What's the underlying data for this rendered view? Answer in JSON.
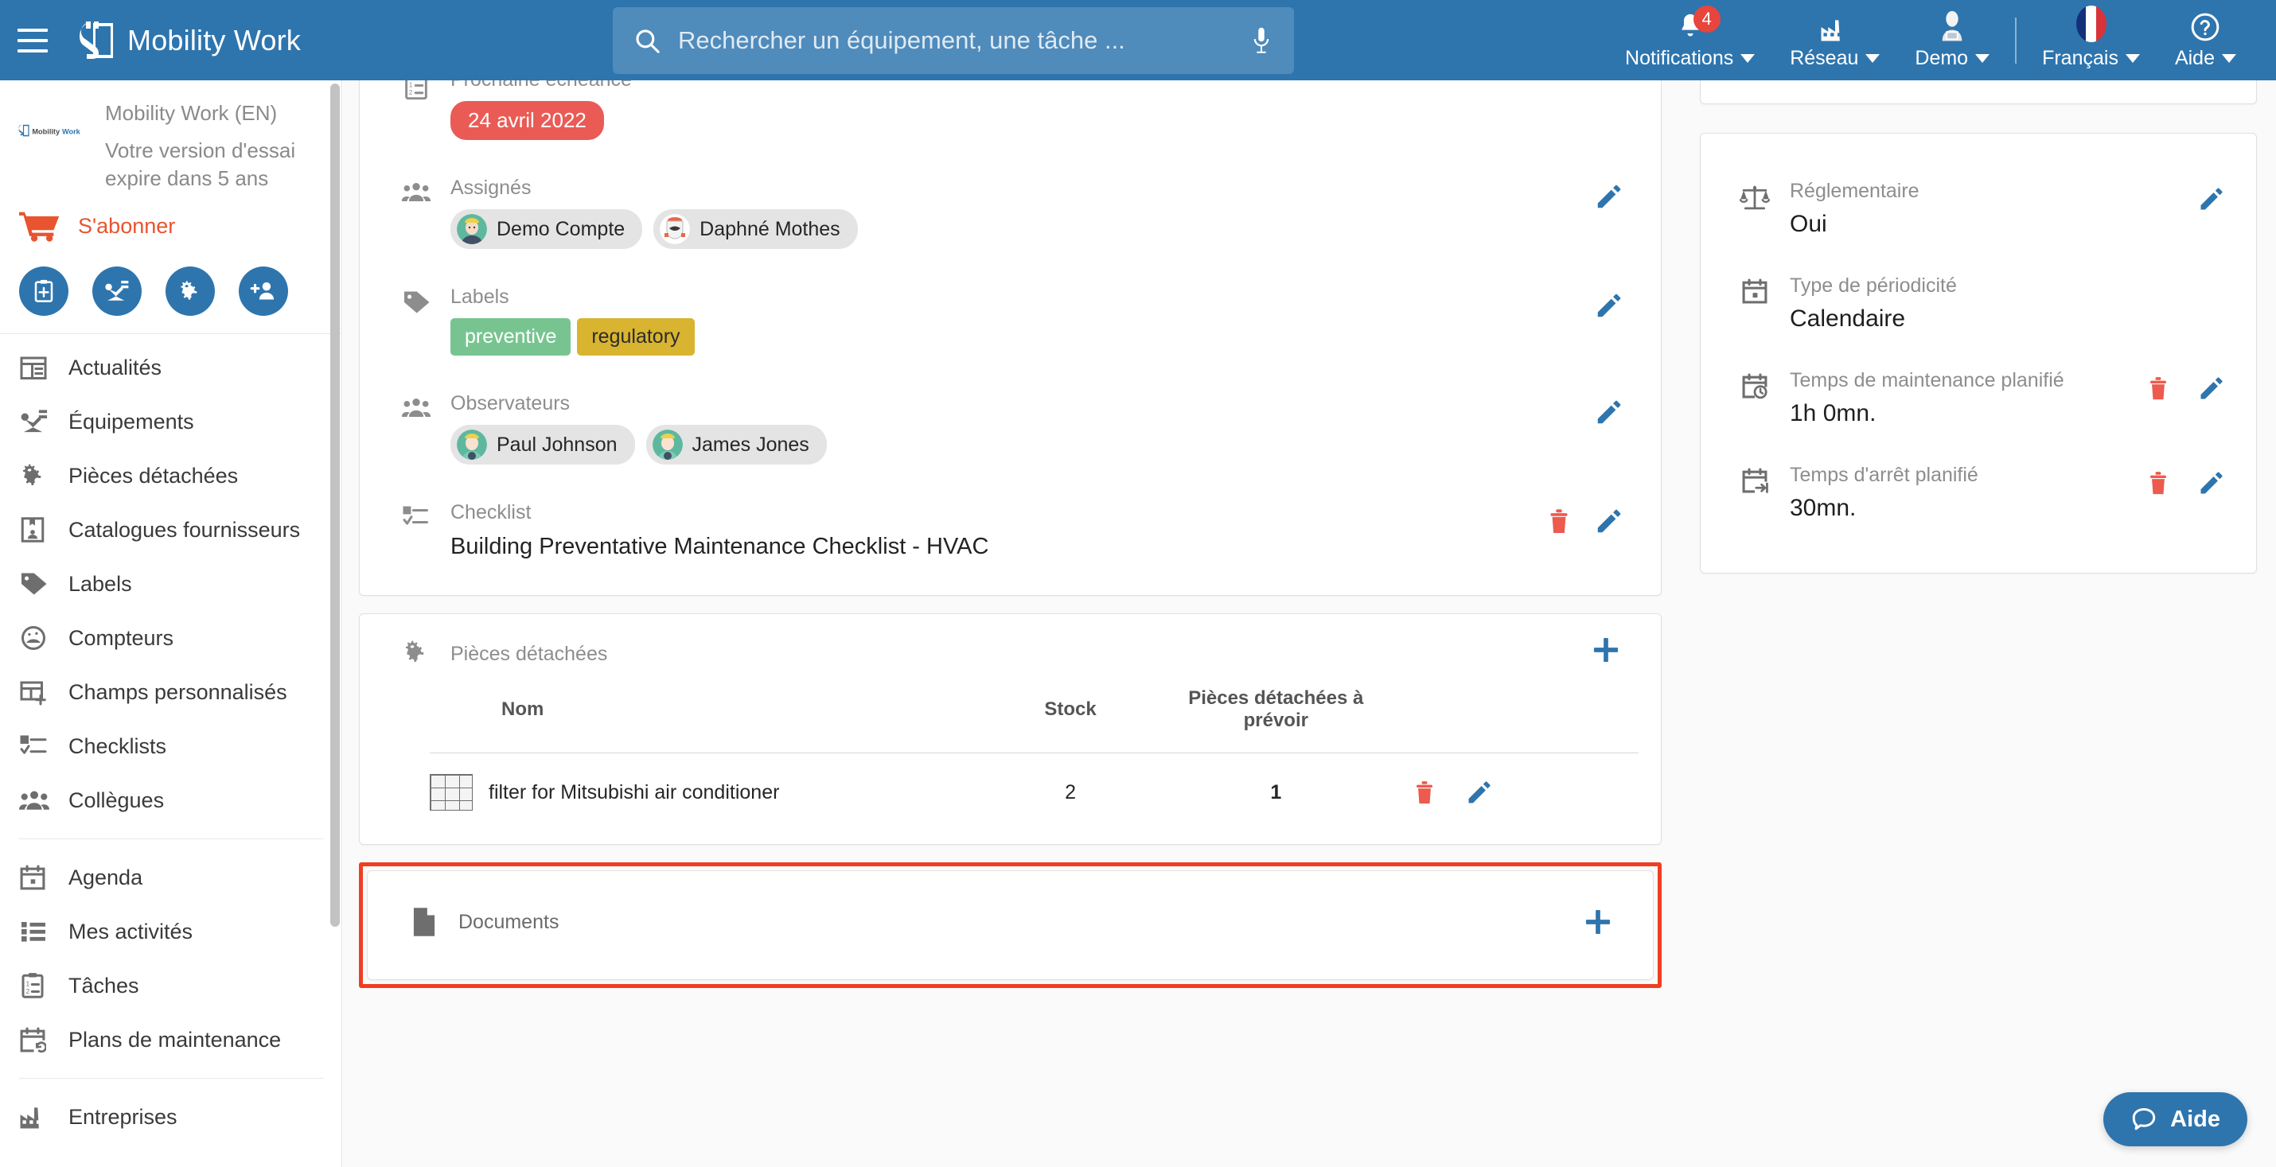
{
  "header": {
    "brand": "Mobility Work",
    "menu_icon": "hamburger-icon",
    "search": {
      "placeholder": "Rechercher un équipement, une tâche ...",
      "value": ""
    },
    "actions": [
      {
        "label": "Notifications",
        "badge": "4",
        "icon": "bell-icon"
      },
      {
        "label": "Réseau",
        "icon": "factory-icon"
      },
      {
        "label": "Demo",
        "icon": "user-avatar-icon"
      },
      {
        "label": "Français",
        "icon": "flag-fr-icon"
      },
      {
        "label": "Aide",
        "icon": "question-circle-icon"
      }
    ]
  },
  "sidebar": {
    "trial": {
      "account": "Mobility Work (EN)",
      "notice": "Votre version d'essai expire dans 5 ans",
      "logo_text": "Mobility Work"
    },
    "subscribe": {
      "label": "S'abonner",
      "icon": "cart-icon",
      "color": "#e8542f"
    },
    "quick_actions": [
      {
        "icon": "clipboard-plus-icon",
        "name": "new-task"
      },
      {
        "icon": "robot-arm-icon",
        "name": "new-equipment"
      },
      {
        "icon": "gears-icon",
        "name": "new-spare-part"
      },
      {
        "icon": "user-plus-icon",
        "name": "invite-colleague"
      }
    ],
    "items": [
      {
        "label": "Actualités",
        "icon": "news-icon"
      },
      {
        "label": "Équipements",
        "icon": "robot-arm-icon"
      },
      {
        "label": "Pièces détachées",
        "icon": "gears-icon"
      },
      {
        "label": "Catalogues fournisseurs",
        "icon": "catalog-icon"
      },
      {
        "label": "Labels",
        "icon": "tag-icon"
      },
      {
        "label": "Compteurs",
        "icon": "gauge-icon"
      },
      {
        "label": "Champs personnalisés",
        "icon": "table-plus-icon"
      },
      {
        "label": "Checklists",
        "icon": "checklist-icon"
      },
      {
        "label": "Collègues",
        "icon": "people-icon"
      },
      {
        "label": "Agenda",
        "icon": "calendar-icon"
      },
      {
        "label": "Mes activités",
        "icon": "list-icon"
      },
      {
        "label": "Tâches",
        "icon": "clipboard-list-icon"
      },
      {
        "label": "Plans de maintenance",
        "icon": "calendar-repeat-icon"
      },
      {
        "label": "Entreprises",
        "icon": "factory-icon"
      }
    ]
  },
  "main": {
    "due_date": {
      "label": "Prochaine échéance",
      "value": "24 avril 2022",
      "icon": "clipboard-list-icon",
      "color": "#ea5b55"
    },
    "assignees": {
      "label": "Assignés",
      "icon": "people-icon",
      "people": [
        "Demo Compte",
        "Daphné Mothes"
      ]
    },
    "labels": {
      "label": "Labels",
      "icon": "tag-icon",
      "tags": [
        {
          "text": "preventive",
          "bg": "#78c490",
          "fg": "#ffffff"
        },
        {
          "text": "regulatory",
          "bg": "#d9b430",
          "fg": "#2b2b2b"
        }
      ]
    },
    "observers": {
      "label": "Observateurs",
      "icon": "people-icon",
      "people": [
        "Paul Johnson",
        "James Jones"
      ]
    },
    "checklist": {
      "label": "Checklist",
      "icon": "checklist-icon",
      "value": "Building Preventative Maintenance Checklist - HVAC"
    },
    "spare_parts": {
      "title": "Pièces détachées",
      "icon": "gears-icon",
      "add_icon": "plus-icon",
      "columns": [
        "Nom",
        "Stock",
        "Pièces détachées à prévoir"
      ],
      "rows": [
        {
          "name": "filter for Mitsubishi air conditioner",
          "stock": "2",
          "planned": "1",
          "thumb": "air-filter-thumbnail"
        }
      ]
    },
    "documents": {
      "title": "Documents",
      "icon": "document-icon",
      "add_icon": "plus-icon",
      "highlight_color": "#f03e22"
    }
  },
  "side_panel": {
    "rows": [
      {
        "label": "Réglementaire",
        "value": "Oui",
        "icon": "scales-icon",
        "has_delete": false
      },
      {
        "label": "Type de périodicité",
        "value": "Calendaire",
        "icon": "calendar-icon",
        "has_delete": false
      },
      {
        "label": "Temps de maintenance planifié",
        "value": "1h 0mn.",
        "icon": "calendar-clock-icon",
        "has_delete": true
      },
      {
        "label": "Temps d'arrêt planifié",
        "value": "30mn.",
        "icon": "calendar-stop-icon",
        "has_delete": true
      }
    ]
  },
  "help_widget": {
    "label": "Aide",
    "icon": "chat-bubble-icon"
  }
}
